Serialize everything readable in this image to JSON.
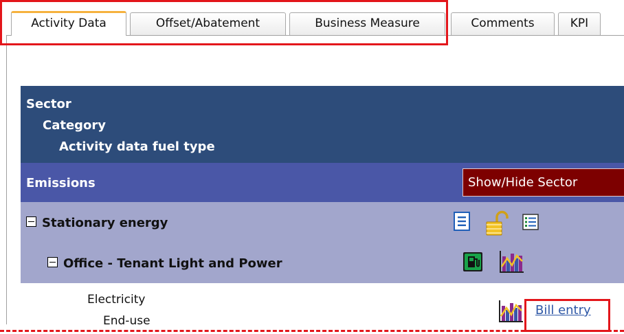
{
  "tabs": [
    {
      "label": "Activity Data",
      "active": true
    },
    {
      "label": "Offset/Abatement",
      "active": false
    },
    {
      "label": "Business Measure",
      "active": false
    },
    {
      "label": "Comments",
      "active": false
    },
    {
      "label": "KPI",
      "active": false
    }
  ],
  "header": {
    "sector": "Sector",
    "category": "Category",
    "fuel_type": "Activity data fuel type",
    "emissions": "Emissions",
    "show_hide_button": "Show/Hide Sector"
  },
  "rows": {
    "stationary": {
      "label": "Stationary energy",
      "icons": [
        "document-list-icon",
        "unlocked-padlock-icon",
        "form-list-icon"
      ]
    },
    "office": {
      "label": "Office - Tenant Light and Power",
      "icons": [
        "fuel-pump-icon",
        "bar-chart-icon"
      ]
    }
  },
  "activity": {
    "name": "Electricity",
    "subtype": "End-use",
    "icon": "bar-chart-icon",
    "link": "Bill entry"
  },
  "colors": {
    "highlight": "#e3161b",
    "active_tab_accent": "#f6b23e",
    "header_dark": "#2d4c7a",
    "header_mid": "#4a57a7",
    "row_band": "#a2a6cc",
    "show_hide_bg": "#7d0000",
    "link": "#2e57a6"
  }
}
